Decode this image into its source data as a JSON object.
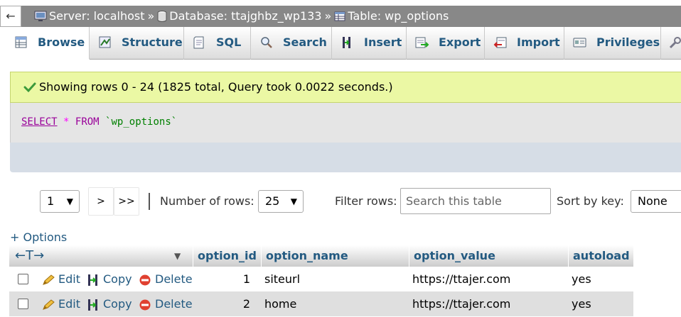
{
  "breadcrumb": {
    "collapse_glyph": "←",
    "server": "Server: localhost",
    "database": "Database: ttajghbz_wp133",
    "table": "Table: wp_options",
    "separator": "»"
  },
  "tabs": [
    {
      "label": "Browse",
      "icon": "browse-icon",
      "active": true
    },
    {
      "label": "Structure",
      "icon": "structure-icon"
    },
    {
      "label": "SQL",
      "icon": "sql-icon"
    },
    {
      "label": "Search",
      "icon": "search-icon"
    },
    {
      "label": "Insert",
      "icon": "insert-icon"
    },
    {
      "label": "Export",
      "icon": "export-icon"
    },
    {
      "label": "Import",
      "icon": "import-icon"
    },
    {
      "label": "Privileges",
      "icon": "privileges-icon"
    }
  ],
  "message": {
    "text": "Showing rows 0 - 24 (1825 total, Query took 0.0022 seconds.)",
    "icon": "check-icon"
  },
  "query": {
    "select": "SELECT",
    "star": "*",
    "from": "FROM",
    "table": "`wp_options`"
  },
  "nav": {
    "page_value": "1",
    "next_label": ">",
    "last_label": ">>",
    "rows_label": "Number of rows:",
    "rows_value": "25",
    "filter_label": "Filter rows:",
    "filter_placeholder": "Search this table",
    "sort_label": "Sort by key:",
    "sort_value": "None"
  },
  "options_link": "+ Options",
  "table": {
    "arrows": "←T→",
    "columns": [
      "option_id",
      "option_name",
      "option_value",
      "autoload"
    ],
    "actions": {
      "edit": "Edit",
      "copy": "Copy",
      "delete": "Delete"
    },
    "rows": [
      {
        "option_id": "1",
        "option_name": "siteurl",
        "option_value": "https://ttajer.com",
        "autoload": "yes"
      },
      {
        "option_id": "2",
        "option_name": "home",
        "option_value": "https://ttajer.com",
        "autoload": "yes"
      }
    ]
  },
  "colors": {
    "link": "#235a81",
    "success_bg": "#ebf8a4",
    "breadcrumb_bg": "#888888",
    "row_alt": "#dfdfdf"
  }
}
